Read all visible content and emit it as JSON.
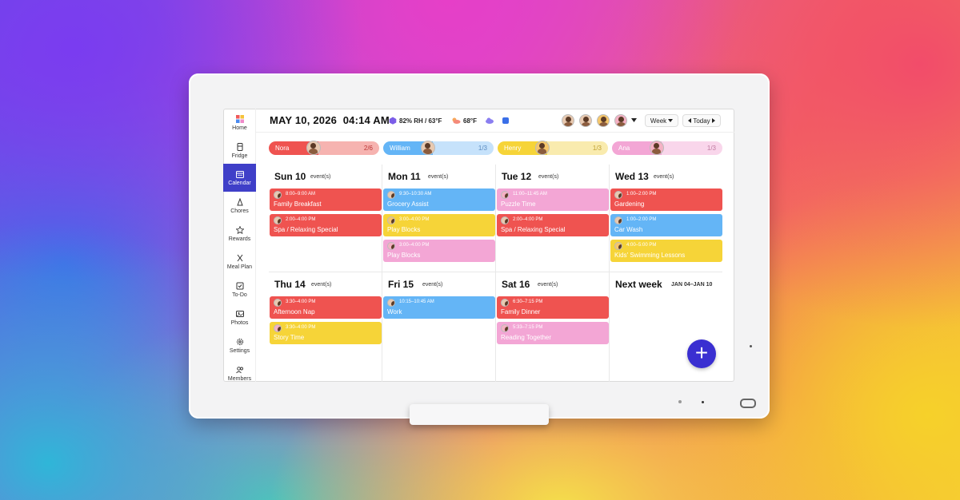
{
  "colors": {
    "red": "#ef5350",
    "blue": "#64b5f6",
    "yellow": "#f6d438",
    "pink": "#f3a6d5",
    "accent": "#3f3fc8",
    "fab": "#3a2fd1"
  },
  "sidebar": {
    "items": [
      {
        "label": "Home",
        "icon": "home-icon"
      },
      {
        "label": "Fridge",
        "icon": "fridge-icon"
      },
      {
        "label": "Calendar",
        "icon": "calendar-icon",
        "active": true
      },
      {
        "label": "Chores",
        "icon": "chores-icon"
      },
      {
        "label": "Rewards",
        "icon": "star-icon"
      },
      {
        "label": "Meal Plan",
        "icon": "utensils-icon"
      },
      {
        "label": "To-Do",
        "icon": "checklist-icon"
      },
      {
        "label": "Photos",
        "icon": "photos-icon"
      },
      {
        "label": "Settings",
        "icon": "gear-icon"
      },
      {
        "label": "Members",
        "icon": "members-icon"
      }
    ]
  },
  "header": {
    "date": "MAY 10, 2026",
    "time": "04:14 AM",
    "humidity": "82% RH / 63°F",
    "temperature": "68°F",
    "view_select": "Week",
    "today_button": "Today"
  },
  "members": [
    {
      "name": "Nora",
      "count": "2/6",
      "color": "#ef5350",
      "bg": "#f6b3b0"
    },
    {
      "name": "William",
      "count": "1/3",
      "color": "#64b5f6",
      "bg": "#c6e2fb"
    },
    {
      "name": "Henry",
      "count": "1/3",
      "color": "#f6d438",
      "bg": "#f9ebae"
    },
    {
      "name": "Ana",
      "count": "1/3",
      "color": "#f3a6d5",
      "bg": "#f9d6eb"
    }
  ],
  "days": [
    {
      "title": "Sun 10",
      "sub": "event(s)",
      "events": [
        {
          "time": "8:00–9:00 AM",
          "title": "Family Breakfast",
          "color": "red"
        },
        {
          "time": "2:00–4:00 PM",
          "title": "Spa / Relaxing Special",
          "color": "red"
        }
      ]
    },
    {
      "title": "Mon 11",
      "sub": "event(s)",
      "events": [
        {
          "time": "9:30–10:30 AM",
          "title": "Grocery Assist",
          "color": "blue"
        },
        {
          "time": "3:00–4:00 PM",
          "title": "Play Blocks",
          "color": "yellow"
        },
        {
          "time": "3:00–4:00 PM",
          "title": "Play Blocks",
          "color": "pink"
        }
      ]
    },
    {
      "title": "Tue 12",
      "sub": "event(s)",
      "events": [
        {
          "time": "11:00–11:45 AM",
          "title": "Puzzle Time",
          "color": "pink"
        },
        {
          "time": "2:00–4:00 PM",
          "title": "Spa / Relaxing Special",
          "color": "red"
        }
      ]
    },
    {
      "title": "Wed 13",
      "sub": "event(s)",
      "events": [
        {
          "time": "1:00–2:00 PM",
          "title": "Gardening",
          "color": "red"
        },
        {
          "time": "1:00–2:00 PM",
          "title": "Car Wash",
          "color": "blue"
        },
        {
          "time": "4:00–5:00 PM",
          "title": "Kids' Swimming Lessons",
          "color": "yellow"
        }
      ]
    },
    {
      "title": "Thu 14",
      "sub": "event(s)",
      "events": [
        {
          "time": "3:30–4:00 PM",
          "title": "Afternoon Nap",
          "color": "red"
        },
        {
          "time": "3:30–4:00 PM",
          "title": "Story Time",
          "color": "yellow"
        }
      ]
    },
    {
      "title": "Fri 15",
      "sub": "event(s)",
      "events": [
        {
          "time": "10:15–10:45 AM",
          "title": "Work",
          "color": "blue"
        }
      ]
    },
    {
      "title": "Sat 16",
      "sub": "event(s)",
      "events": [
        {
          "time": "6:30–7:15 PM",
          "title": "Family Dinner",
          "color": "red"
        },
        {
          "time": "5:33–7:15 PM",
          "title": "Reading Together",
          "color": "pink"
        }
      ]
    },
    {
      "title": "Next week",
      "sub": "JAN 04–JAN 10",
      "events": []
    }
  ],
  "fab_label": "+"
}
